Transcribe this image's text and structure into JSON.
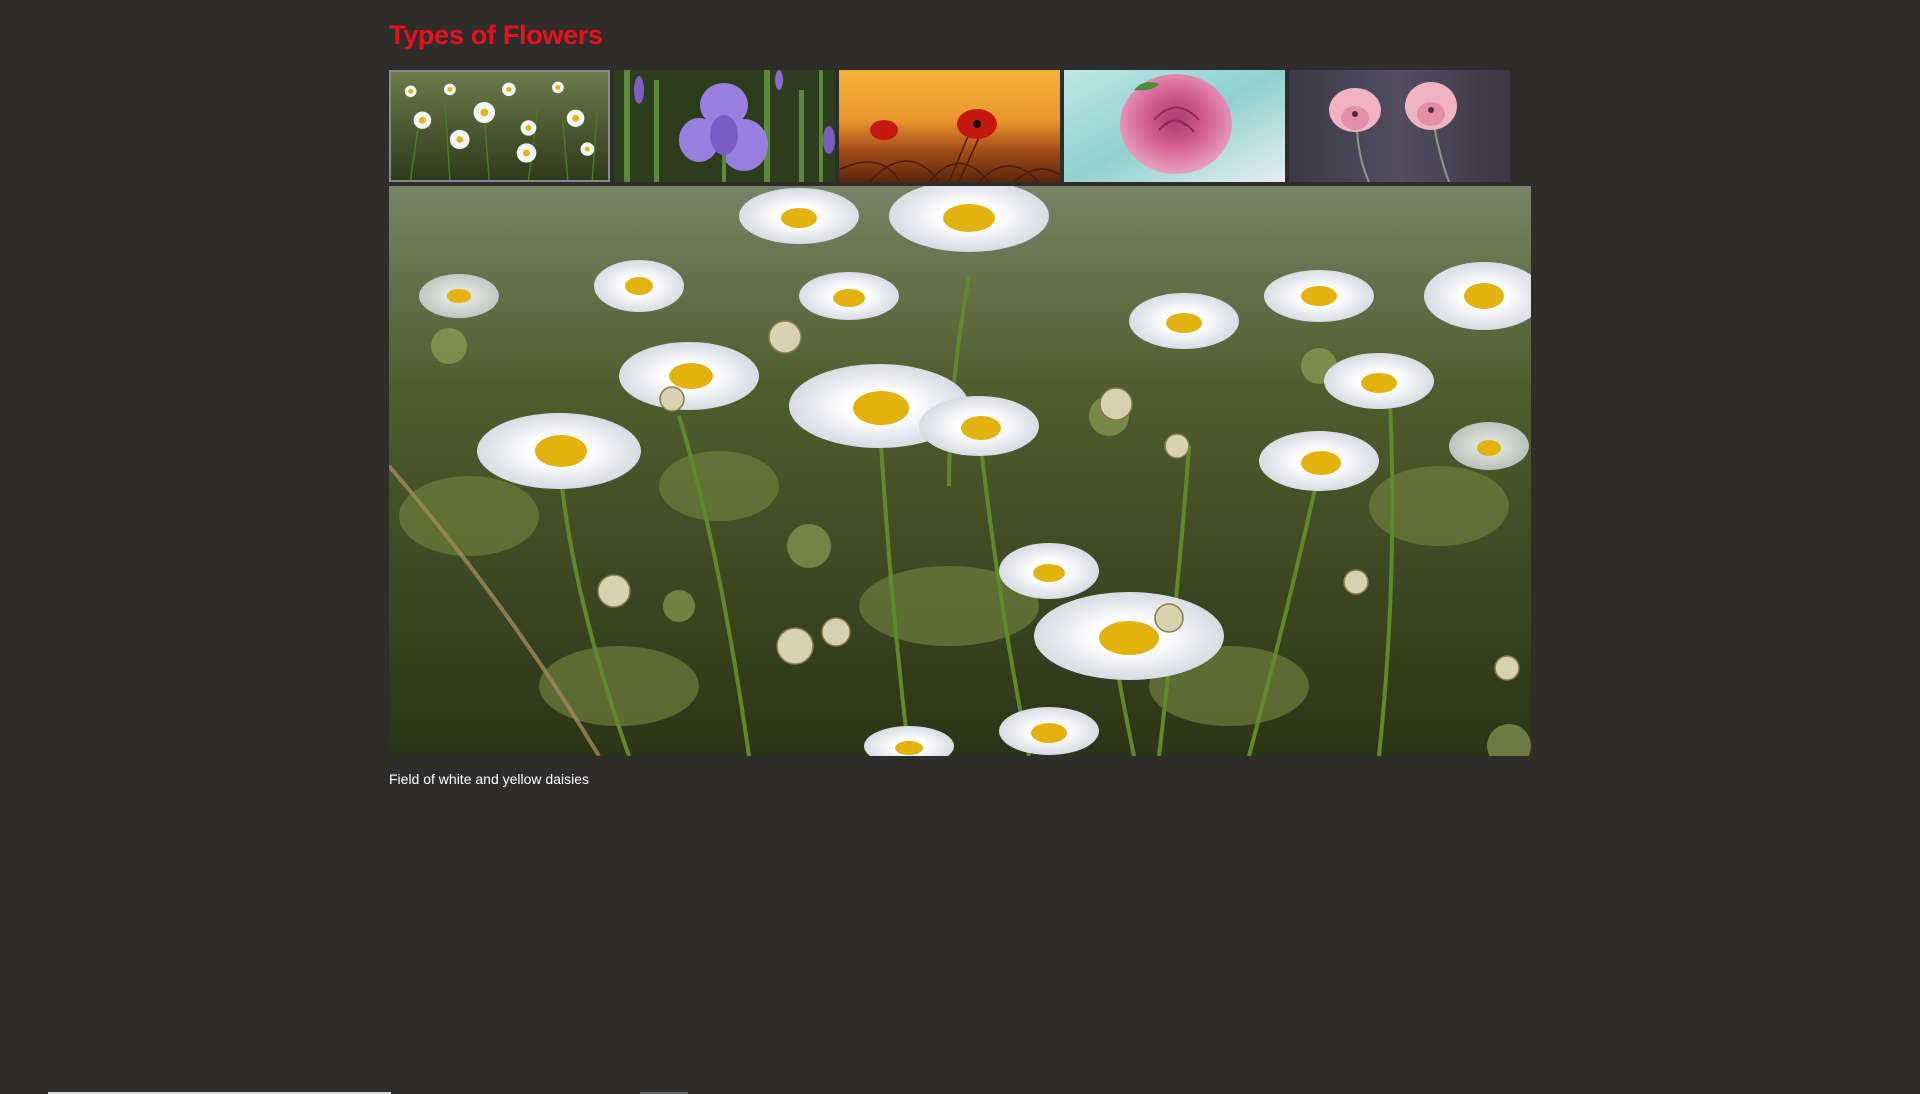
{
  "page": {
    "title": "Types of Flowers"
  },
  "thumbnails": [
    {
      "icon": "daisies-thumbnail",
      "active": true
    },
    {
      "icon": "iris-thumbnail",
      "active": false
    },
    {
      "icon": "poppy-thumbnail",
      "active": false
    },
    {
      "icon": "rose-thumbnail",
      "active": false
    },
    {
      "icon": "tulips-thumbnail",
      "active": false
    }
  ],
  "main": {
    "icon": "daisies-main-image",
    "caption": "Field of white and yellow daisies"
  },
  "colors": {
    "background": "#2e2d2c",
    "title": "#e8101a",
    "caption": "#ffffff"
  }
}
